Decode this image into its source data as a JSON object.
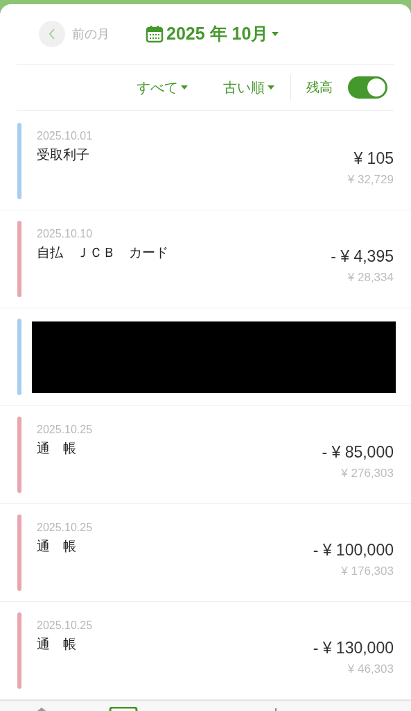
{
  "header": {
    "prev_label": "前の月",
    "month": "2025 年 10月"
  },
  "filters": {
    "category": "すべて",
    "order": "古い順",
    "balance_label": "残高",
    "balance_on": true
  },
  "rows": [
    {
      "kind": "entry",
      "color": "#a8cdef",
      "date": "2025.10.01",
      "name": "受取利子",
      "amount": "¥ 105",
      "balance": "¥ 32,729"
    },
    {
      "kind": "entry",
      "color": "#e8a6b0",
      "date": "2025.10.10",
      "name": "自払　ＪＣＢ　カード",
      "amount": "- ¥ 4,395",
      "balance": "¥ 28,334"
    },
    {
      "kind": "redacted",
      "color": "#a8cdef"
    },
    {
      "kind": "entry",
      "color": "#e8a6b0",
      "date": "2025.10.25",
      "name": "通　帳",
      "amount": "- ¥ 85,000",
      "balance": "¥ 276,303"
    },
    {
      "kind": "entry",
      "color": "#e8a6b0",
      "date": "2025.10.25",
      "name": "通　帳",
      "amount": "- ¥ 100,000",
      "balance": "¥ 176,303"
    },
    {
      "kind": "entry",
      "color": "#e8a6b0",
      "date": "2025.10.25",
      "name": "通　帳",
      "amount": "- ¥ 130,000",
      "balance": "¥ 46,303"
    }
  ]
}
